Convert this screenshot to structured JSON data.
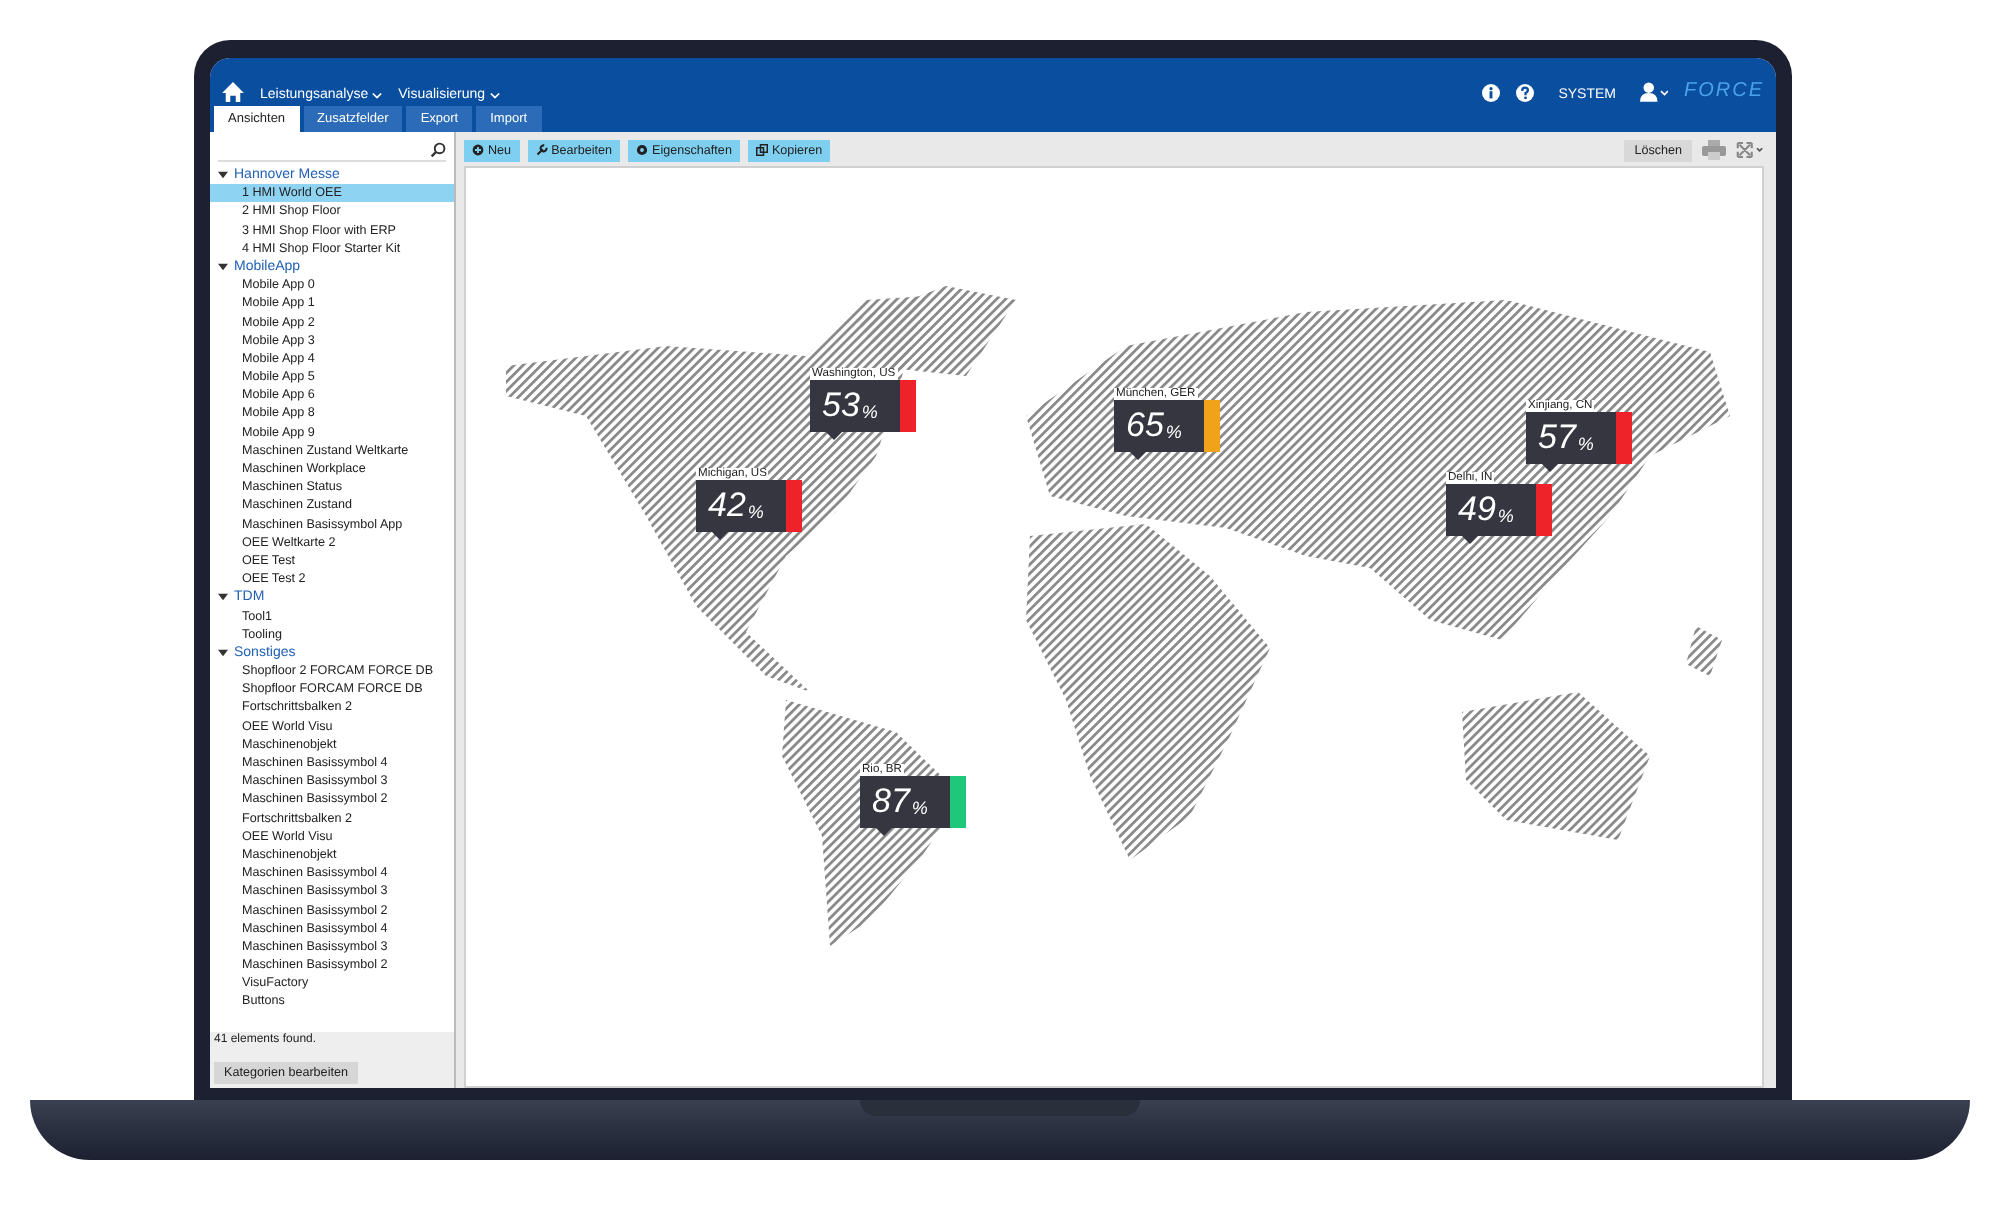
{
  "header": {
    "menus": [
      "Leistungsanalyse",
      "Visualisierung"
    ],
    "user": "SYSTEM",
    "logo": "FORCE"
  },
  "tabs": [
    {
      "label": "Ansichten",
      "selected": true
    },
    {
      "label": "Zusatzfelder",
      "selected": false
    },
    {
      "label": "Export",
      "selected": false
    },
    {
      "label": "Import",
      "selected": false
    }
  ],
  "toolbar": {
    "buttons": [
      {
        "label": "Neu",
        "kind": "plus"
      },
      {
        "label": "Bearbeiten",
        "kind": "wrench"
      },
      {
        "label": "Eigenschaften",
        "kind": "gear"
      },
      {
        "label": "Kopieren",
        "kind": "copy"
      }
    ],
    "delete": "Löschen"
  },
  "sidebar": {
    "categories": [
      {
        "name": "Hannover Messe",
        "expanded": true,
        "children": [
          {
            "label": "1 HMI World OEE",
            "selected": true
          },
          {
            "label": "2 HMI Shop Floor",
            "selected": false
          },
          {
            "label": "3 HMI Shop Floor with ERP",
            "selected": false
          },
          {
            "label": "4 HMI Shop Floor Starter Kit",
            "selected": false
          }
        ]
      },
      {
        "name": "MobileApp",
        "expanded": true,
        "children": [
          {
            "label": "Mobile App 0",
            "selected": false
          },
          {
            "label": "Mobile App 1",
            "selected": false
          },
          {
            "label": "Mobile App 2",
            "selected": false
          },
          {
            "label": "Mobile App 3",
            "selected": false
          },
          {
            "label": "Mobile App 4",
            "selected": false
          },
          {
            "label": "Mobile App 5",
            "selected": false
          },
          {
            "label": "Mobile App 6",
            "selected": false
          },
          {
            "label": "Mobile App 8",
            "selected": false
          },
          {
            "label": "Mobile App 9",
            "selected": false
          },
          {
            "label": "Maschinen Zustand Weltkarte",
            "selected": false
          },
          {
            "label": "Maschinen Workplace",
            "selected": false
          },
          {
            "label": "Maschinen Status",
            "selected": false
          },
          {
            "label": "Maschinen Zustand",
            "selected": false
          },
          {
            "label": "Maschinen Basissymbol App",
            "selected": false
          },
          {
            "label": "OEE Weltkarte 2",
            "selected": false
          },
          {
            "label": "OEE Test",
            "selected": false
          },
          {
            "label": "OEE Test 2",
            "selected": false
          }
        ]
      },
      {
        "name": "TDM",
        "expanded": true,
        "children": [
          {
            "label": "Tool1",
            "selected": false
          },
          {
            "label": "Tooling",
            "selected": false
          }
        ]
      },
      {
        "name": "Sonstiges",
        "expanded": true,
        "children": [
          {
            "label": "Shopfloor 2 FORCAM FORCE DB",
            "selected": false
          },
          {
            "label": "Shopfloor FORCAM FORCE DB",
            "selected": false
          },
          {
            "label": "Fortschrittsbalken 2",
            "selected": false
          },
          {
            "label": "OEE World Visu",
            "selected": false
          },
          {
            "label": "Maschinenobjekt",
            "selected": false
          },
          {
            "label": "Maschinen Basissymbol 4",
            "selected": false
          },
          {
            "label": "Maschinen Basissymbol 3",
            "selected": false
          },
          {
            "label": "Maschinen Basissymbol 2",
            "selected": false
          },
          {
            "label": "Fortschrittsbalken 2",
            "selected": false
          },
          {
            "label": "OEE World Visu",
            "selected": false
          },
          {
            "label": "Maschinenobjekt",
            "selected": false
          },
          {
            "label": "Maschinen Basissymbol 4",
            "selected": false
          },
          {
            "label": "Maschinen Basissymbol 3",
            "selected": false
          },
          {
            "label": "Maschinen Basissymbol 2",
            "selected": false
          },
          {
            "label": "Maschinen Basissymbol 4",
            "selected": false
          },
          {
            "label": "Maschinen Basissymbol 3",
            "selected": false
          },
          {
            "label": "Maschinen Basissymbol 2",
            "selected": false
          },
          {
            "label": "VisuFactory",
            "selected": false
          },
          {
            "label": "Buttons",
            "selected": false
          }
        ]
      }
    ],
    "status": "41 elements found.",
    "edit_button": "Kategorien bearbeiten"
  },
  "markers": [
    {
      "label": "Washington, US",
      "value": "53",
      "unit": "%",
      "color": "#ee2229"
    },
    {
      "label": "Michigan, US",
      "value": "42",
      "unit": "%",
      "color": "#ee2229"
    },
    {
      "label": "München, GER",
      "value": "65",
      "unit": "%",
      "color": "#f0a21a"
    },
    {
      "label": "Xinjiang, CN",
      "value": "57",
      "unit": "%",
      "color": "#ee2229"
    },
    {
      "label": "Delhi, IN",
      "value": "49",
      "unit": "%",
      "color": "#ee2229"
    },
    {
      "label": "Rio, BR",
      "value": "87",
      "unit": "%",
      "color": "#1fc77a"
    }
  ]
}
